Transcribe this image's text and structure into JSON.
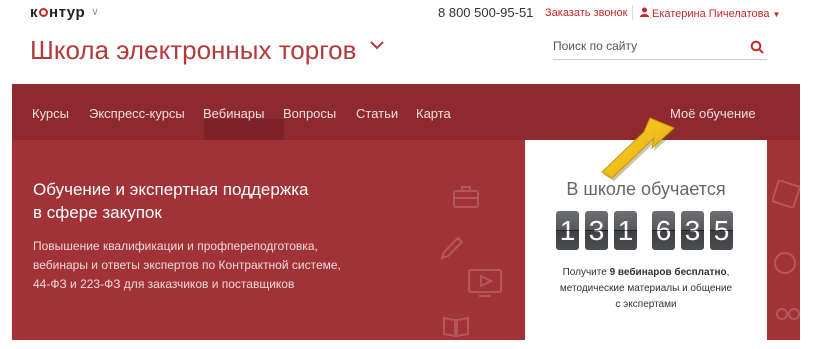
{
  "header": {
    "logo_part1": "к",
    "logo_part2": "нтур",
    "logo_chevron": "∨",
    "phone": "8 800 500-95-51",
    "callback_link": "Заказать звонок",
    "user_name": "Екатерина Пичелатова",
    "user_icon": "user-icon",
    "user_caret": "▼"
  },
  "site": {
    "title": "Школа электронных торгов"
  },
  "search": {
    "placeholder": "Поиск по сайту",
    "value": ""
  },
  "nav": {
    "items": [
      "Курсы",
      "Экспресс-курсы",
      "Вебинары",
      "Вопросы",
      "Статьи",
      "Карта"
    ],
    "right_item": "Моё обучение"
  },
  "hero": {
    "heading_line1": "Обучение и экспертная поддержка",
    "heading_line2": "в сфере закупок",
    "text_line1": "Повышение квалификации и профпереподготовка,",
    "text_line2": "вебинары и ответы экспертов по Контрактной системе,",
    "text_line3": "44-ФЗ и 223-ФЗ для заказчиков и поставщиков"
  },
  "counter": {
    "title": "В школе обучается",
    "digits": [
      "1",
      "3",
      "1",
      "6",
      "3",
      "5"
    ],
    "note_prefix": "Получите ",
    "note_bold": "9 вебинаров бесплатно",
    "note_suffix": ",",
    "note_line2": "методические материалы и общение",
    "note_line3": "с экспертами"
  },
  "colors": {
    "brand_red": "#c62828",
    "nav_bg": "#8e2a2f",
    "hero_bg": "#a13338",
    "arrow": "#f2c21a"
  }
}
